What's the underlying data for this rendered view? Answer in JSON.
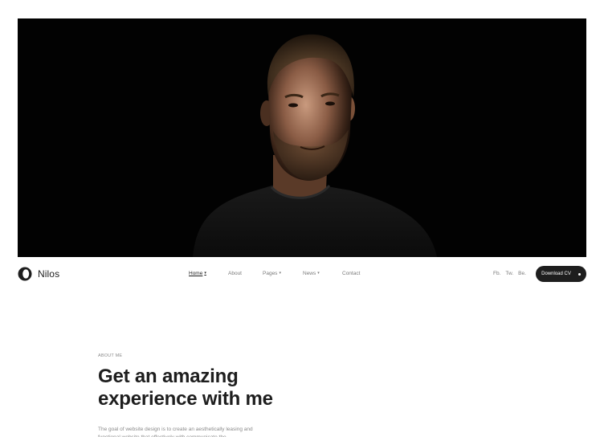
{
  "brand": {
    "name": "Nilos",
    "logo_icon": "ring-logo-icon"
  },
  "nav": {
    "items": [
      {
        "label": "Home",
        "has_dropdown": true,
        "active": true
      },
      {
        "label": "About",
        "has_dropdown": false,
        "active": false
      },
      {
        "label": "Pages",
        "has_dropdown": true,
        "active": false
      },
      {
        "label": "News",
        "has_dropdown": true,
        "active": false
      },
      {
        "label": "Contact",
        "has_dropdown": false,
        "active": false
      }
    ],
    "caret_icon": "chevron-down-icon"
  },
  "socials": [
    "Fb.",
    "Tw.",
    "Be."
  ],
  "cta": {
    "label": "Download CV"
  },
  "about": {
    "eyebrow": "ABOUT ME",
    "headline_line1": "Get an amazing",
    "headline_line2": "experience with me",
    "body": "The goal of website design is to create an aesthetically leasing and functional website that effectively with communicate the"
  },
  "colors": {
    "dark": "#1e1e1e",
    "muted": "#8a8a8a",
    "hero_bg": "#000000"
  }
}
